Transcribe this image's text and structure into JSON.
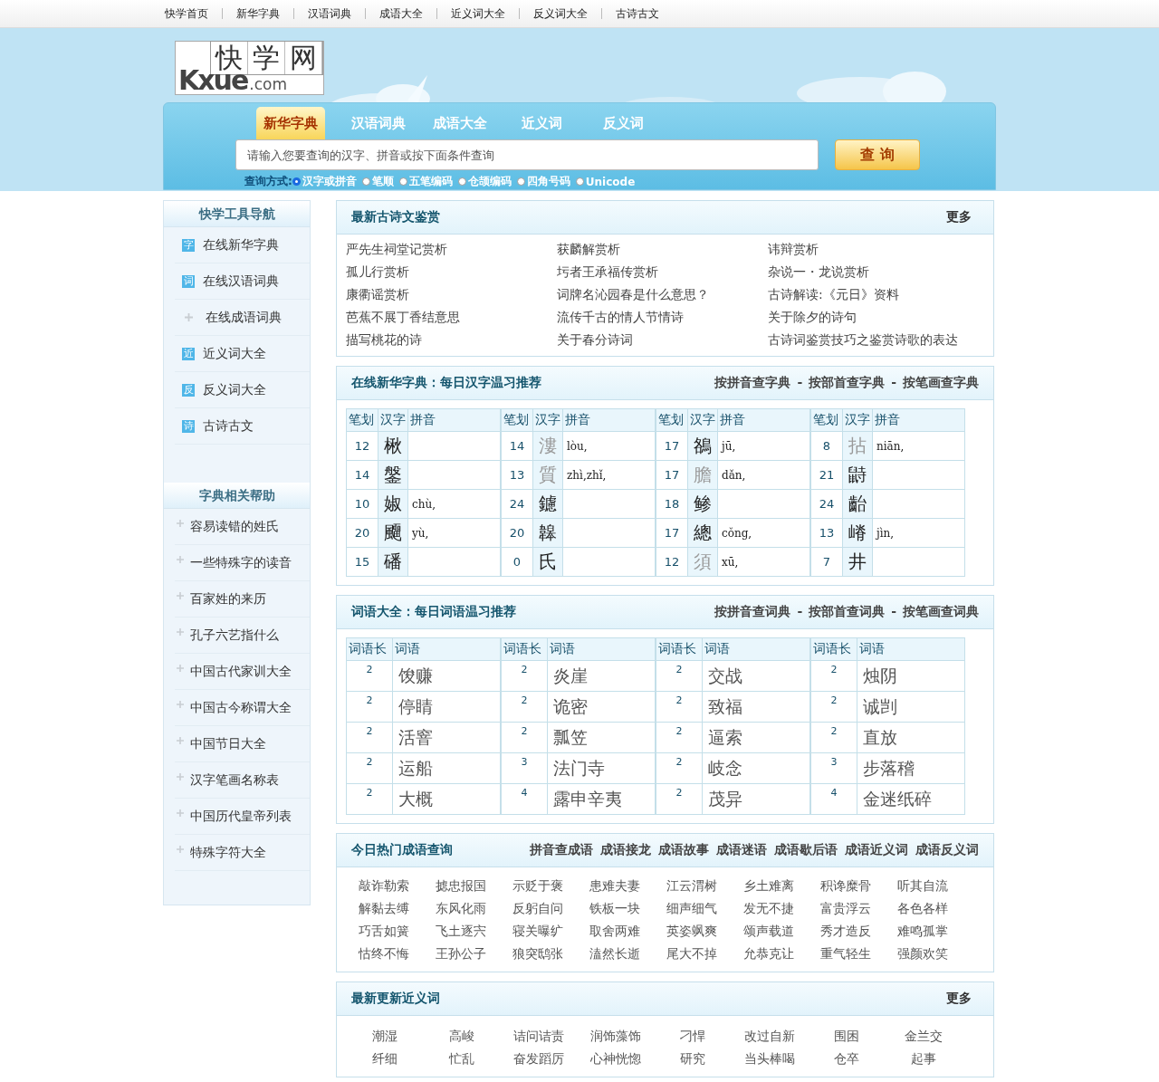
{
  "top_nav": [
    "快学首页",
    "新华字典",
    "汉语词典",
    "成语大全",
    "近义词大全",
    "反义词大全",
    "古诗古文"
  ],
  "logo": {
    "chars": [
      "快",
      "学",
      "网"
    ],
    "mark": "Kxue",
    "domain": ".com"
  },
  "search": {
    "tabs": [
      {
        "label": "新华字典",
        "selected": true
      },
      {
        "label": "汉语词典",
        "selected": false
      },
      {
        "label": "成语大全",
        "selected": false
      },
      {
        "label": "近义词",
        "selected": false
      },
      {
        "label": "反义词",
        "selected": false
      }
    ],
    "placeholder": "请输入您要查询的汉字、拼音或按下面条件查询",
    "button": "查 询",
    "mode_label": "查询方式:",
    "modes": [
      {
        "label": "汉字或拼音",
        "selected": true
      },
      {
        "label": "笔顺",
        "selected": false
      },
      {
        "label": "五笔编码",
        "selected": false
      },
      {
        "label": "仓颉编码",
        "selected": false
      },
      {
        "label": "四角号码",
        "selected": false
      },
      {
        "label": "Unicode",
        "selected": false
      }
    ]
  },
  "sidebar": {
    "sections": [
      {
        "title": "快学工具导航",
        "items": [
          {
            "label": "在线新华字典",
            "kind": "badge",
            "badge": "字"
          },
          {
            "label": "在线汉语词典",
            "kind": "badge",
            "badge": "词"
          },
          {
            "label": "在线成语词典",
            "kind": "plus"
          },
          {
            "label": "近义词大全",
            "kind": "badge",
            "badge": "近"
          },
          {
            "label": "反义词大全",
            "kind": "badge",
            "badge": "反"
          },
          {
            "label": "古诗古文",
            "kind": "badge",
            "badge": "诗"
          }
        ]
      },
      {
        "title": "字典相关帮助",
        "items": [
          {
            "label": "容易读错的姓氏",
            "kind": "bullet"
          },
          {
            "label": "一些特殊字的读音",
            "kind": "bullet"
          },
          {
            "label": "百家姓的来历",
            "kind": "bullet"
          },
          {
            "label": "孔子六艺指什么",
            "kind": "bullet"
          },
          {
            "label": "中国古代家训大全",
            "kind": "bullet"
          },
          {
            "label": "中国古今称谓大全",
            "kind": "bullet"
          },
          {
            "label": "中国节日大全",
            "kind": "bullet"
          },
          {
            "label": "汉字笔画名称表",
            "kind": "bullet"
          },
          {
            "label": "中国历代皇帝列表",
            "kind": "bullet"
          },
          {
            "label": "特殊字符大全",
            "kind": "bullet"
          }
        ]
      }
    ]
  },
  "poems": {
    "title": "最新古诗文鉴赏",
    "more": "更多",
    "items": [
      "严先生祠堂记赏析",
      "获麟解赏析",
      "讳辩赏析",
      "孤儿行赏析",
      "圬者王承福传赏析",
      "杂说一・龙说赏析",
      "康衢谣赏析",
      "词牌名沁园春是什么意思？",
      "古诗解读:《元日》资料",
      "芭蕉不展丁香结意思",
      "流传千古的情人节情诗",
      "关于除夕的诗句",
      "描写桃花的诗",
      "关于春分诗词",
      "古诗词鉴赏技巧之鉴赏诗歌的表达"
    ]
  },
  "chars": {
    "title": "在线新华字典：每日汉字温习推荐",
    "links": [
      {
        "label": "按拼音查字典"
      },
      {
        "sep": "-",
        "label": "按部首查字典"
      },
      {
        "sep": "-",
        "label": "按笔画查字典"
      }
    ],
    "groups": [
      {
        "columns": [
          "笔划",
          "汉字",
          "拼音"
        ],
        "rows": [
          {
            "strokes": "12",
            "char": "楸",
            "faded": false
          },
          {
            "strokes": "14",
            "char": "鎜",
            "faded": false
          },
          {
            "strokes": "10",
            "char": "婌",
            "pinyin": "chù,",
            "faded": false
          },
          {
            "strokes": "20",
            "char": "飅",
            "pinyin": "yù,",
            "faded": false
          },
          {
            "strokes": "15",
            "char": "磻",
            "faded": false
          }
        ]
      },
      {
        "columns": [
          "笔划",
          "汉字",
          "拼音"
        ],
        "rows": [
          {
            "strokes": "14",
            "char": "漊",
            "pinyin": "lòu,",
            "faded": true
          },
          {
            "strokes": "13",
            "char": "質",
            "pinyin": "zhì,zhǐ,",
            "faded": true
          },
          {
            "strokes": "24",
            "char": "鑢",
            "faded": false
          },
          {
            "strokes": "20",
            "char": "韟",
            "faded": false
          },
          {
            "strokes": "0",
            "char": "氏",
            "faded": false
          }
        ]
      },
      {
        "columns": [
          "笔划",
          "汉字",
          "拼音"
        ],
        "rows": [
          {
            "strokes": "17",
            "char": "鵅",
            "pinyin": "jū,",
            "faded": false
          },
          {
            "strokes": "17",
            "char": "膽",
            "pinyin": "dǎn,",
            "faded": true
          },
          {
            "strokes": "18",
            "char": "鲹",
            "faded": false
          },
          {
            "strokes": "17",
            "char": "總",
            "pinyin": "cǒng,",
            "faded": false
          },
          {
            "strokes": "12",
            "char": "須",
            "pinyin": "xū,",
            "faded": true
          }
        ]
      },
      {
        "columns": [
          "笔划",
          "汉字",
          "拼音"
        ],
        "rows": [
          {
            "strokes": "8",
            "char": "拈",
            "pinyin": "niān,",
            "faded": true
          },
          {
            "strokes": "21",
            "char": "鼭",
            "faded": false
          },
          {
            "strokes": "24",
            "char": "齝",
            "faded": false
          },
          {
            "strokes": "13",
            "char": "嵴",
            "pinyin": "jìn,",
            "faded": false
          },
          {
            "strokes": "7",
            "char": "井",
            "faded": false
          }
        ]
      }
    ]
  },
  "words": {
    "title": "词语大全：每日词语温习推荐",
    "links": [
      {
        "label": "按拼音查词典"
      },
      {
        "sep": "-",
        "label": "按部首查词典"
      },
      {
        "sep": "-",
        "label": "按笔画查词典"
      }
    ],
    "groups": [
      {
        "columns": [
          "词语长",
          "词语"
        ],
        "rows": [
          {
            "len": "2",
            "word": "馂赚"
          },
          {
            "len": "2",
            "word": "停睛"
          },
          {
            "len": "2",
            "word": "活窨"
          },
          {
            "len": "2",
            "word": "运船"
          },
          {
            "len": "2",
            "word": "大概"
          }
        ]
      },
      {
        "columns": [
          "词语长",
          "词语"
        ],
        "rows": [
          {
            "len": "2",
            "word": "炎崖"
          },
          {
            "len": "2",
            "word": "诡密"
          },
          {
            "len": "2",
            "word": "瓢笠"
          },
          {
            "len": "3",
            "word": "法门寺"
          },
          {
            "len": "4",
            "word": "露申辛夷"
          }
        ]
      },
      {
        "columns": [
          "词语长",
          "词语"
        ],
        "rows": [
          {
            "len": "2",
            "word": "交战"
          },
          {
            "len": "2",
            "word": "致福"
          },
          {
            "len": "2",
            "word": "逼索"
          },
          {
            "len": "2",
            "word": "岐念"
          },
          {
            "len": "2",
            "word": "茂异"
          }
        ]
      },
      {
        "columns": [
          "词语长",
          "词语"
        ],
        "rows": [
          {
            "len": "2",
            "word": "烛阴"
          },
          {
            "len": "2",
            "word": "诚剀"
          },
          {
            "len": "2",
            "word": "直放"
          },
          {
            "len": "3",
            "word": "步落稽"
          },
          {
            "len": "4",
            "word": "金迷纸碎"
          }
        ]
      }
    ]
  },
  "idioms": {
    "title": "今日热门成语查询",
    "links": [
      "拼音查成语",
      "成语接龙",
      "成语故事",
      "成语迷语",
      "成语歇后语",
      "成语近义词",
      "成语反义词"
    ],
    "items": [
      "敲诈勒索",
      "摅忠报国",
      "示贬于褒",
      "患难夫妻",
      "江云渭树",
      "乡土难离",
      "积谗糜骨",
      "听其自流",
      "解黏去缚",
      "东风化雨",
      "反躬自问",
      "铁板一块",
      "细声细气",
      "发无不捷",
      "富贵浮云",
      "各色各样",
      "巧舌如簧",
      "飞土逐宍",
      "寝关曝纩",
      "取舍两难",
      "英姿飒爽",
      "颂声载道",
      "秀才造反",
      "难鸣孤掌",
      "怙终不悔",
      "王孙公子",
      "狼突鸱张",
      "溘然长逝",
      "尾大不掉",
      "允恭克让",
      "重气轻生",
      "强颜欢笑"
    ]
  },
  "synonyms": {
    "title": "最新更新近义词",
    "more": "更多",
    "items": [
      "潮湿",
      "高峻",
      "诘问诘责",
      "润饰藻饰",
      "刁悍",
      "改过自新",
      "围困",
      "金兰交",
      "纤细",
      "忙乱",
      "奋发蹈厉",
      "心神恍惚",
      "研究",
      "当头棒喝",
      "仓卒",
      "起事"
    ]
  }
}
